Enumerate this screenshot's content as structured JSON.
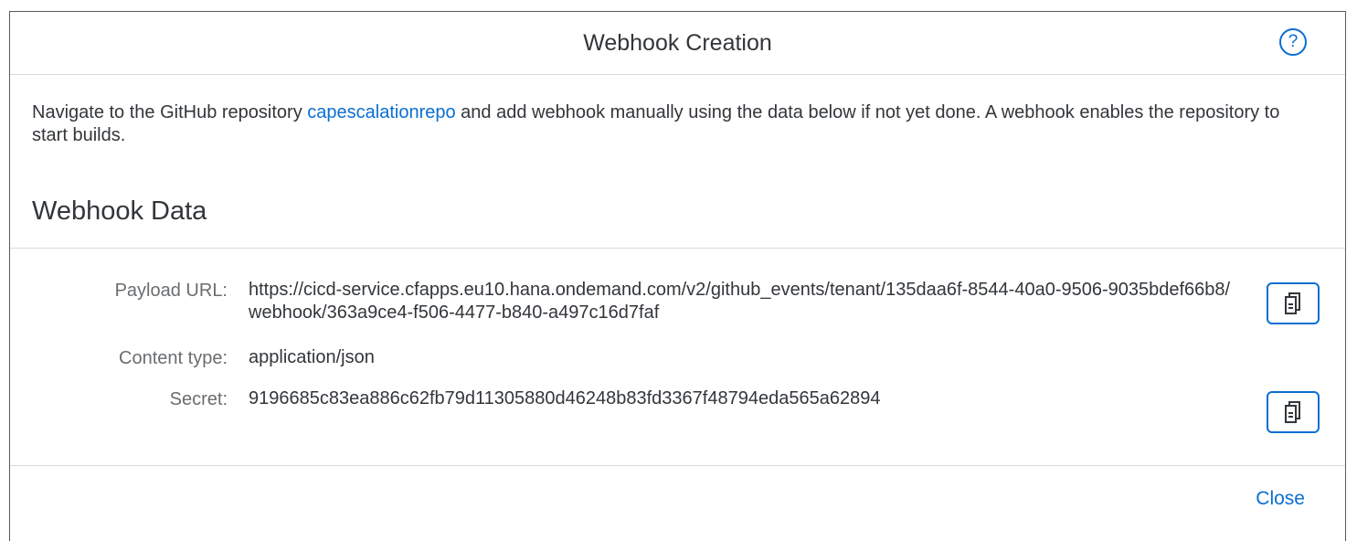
{
  "dialog": {
    "title": "Webhook Creation",
    "help_icon": "help-circle-icon",
    "help_glyph": "?"
  },
  "intro": {
    "before_link": "Navigate to the GitHub repository ",
    "link_text": "capescalationrepo",
    "after_link": " and add webhook manually using the data below if not yet done. A webhook enables the repository to start builds."
  },
  "section": {
    "title": "Webhook Data"
  },
  "fields": [
    {
      "label": "Payload URL:",
      "value": "https://cicd-service.cfapps.eu10.hana.ondemand.com/v2/github_events/tenant/135daa6f-8544-40a0-9506-9035bdef66b8/webhook/363a9ce4-f506-4477-b840-a497c16d7faf",
      "copy_icon": "copy-icon"
    },
    {
      "label": "Content type:",
      "value": "application/json"
    },
    {
      "label": "Secret:",
      "value": "9196685c83ea886c62fb79d11305880d46248b83fd3367f48794eda565a62894",
      "copy_icon": "copy-icon"
    }
  ],
  "footer": {
    "close_label": "Close"
  },
  "colors": {
    "accent": "#0a6ed1",
    "text": "#32363a",
    "label": "#6a6d70",
    "divider": "#d9d9d9"
  }
}
